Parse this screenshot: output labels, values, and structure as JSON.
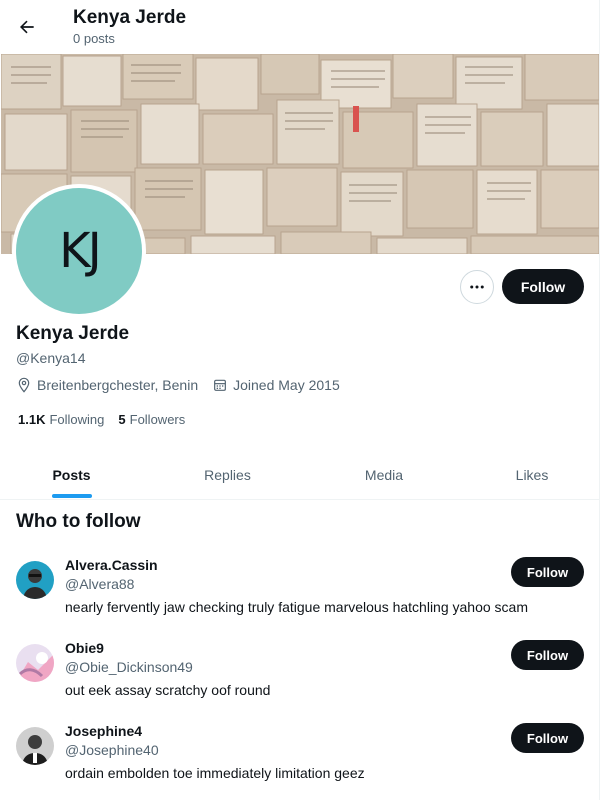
{
  "header": {
    "name": "Kenya Jerde",
    "post_count": "0 posts"
  },
  "profile": {
    "avatar_initials": "KJ",
    "avatar_color": "#80cbc4",
    "name": "Kenya Jerde",
    "handle": "@Kenya14",
    "location": "Breitenbergchester, Benin",
    "joined": "Joined May 2015",
    "following_count": "1.1K",
    "following_label": "Following",
    "followers_count": "5",
    "followers_label": "Followers",
    "follow_label": "Follow"
  },
  "tabs": [
    {
      "label": "Posts",
      "active": true
    },
    {
      "label": "Replies",
      "active": false
    },
    {
      "label": "Media",
      "active": false
    },
    {
      "label": "Likes",
      "active": false
    }
  ],
  "who_to_follow": {
    "title": "Who to follow",
    "users": [
      {
        "name": "Alvera.Cassin",
        "handle": "@Alvera88",
        "bio": "nearly fervently jaw checking truly fatigue marvelous hatchling yahoo scam",
        "follow_label": "Follow"
      },
      {
        "name": "Obie9",
        "handle": "@Obie_Dickinson49",
        "bio": "out eek assay scratchy oof round",
        "follow_label": "Follow"
      },
      {
        "name": "Josephine4",
        "handle": "@Josephine40",
        "bio": "ordain embolden toe immediately limitation geez",
        "follow_label": "Follow"
      }
    ]
  },
  "colors": {
    "accent": "#1d9bf0",
    "button_dark": "#0f1419",
    "muted_text": "#536471"
  },
  "icons": {
    "back": "arrow-left-icon",
    "more": "ellipsis-icon",
    "location": "location-pin-icon",
    "calendar": "calendar-icon"
  }
}
